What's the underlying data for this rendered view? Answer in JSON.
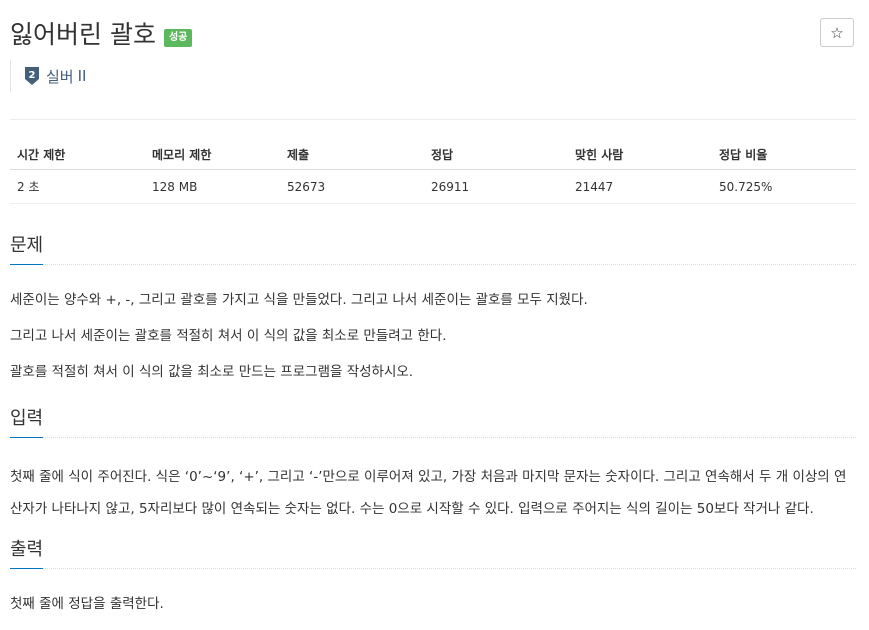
{
  "problem": {
    "title": "잃어버린 괄호",
    "result_badge": "성공",
    "favorite_icon": "☆",
    "tier": {
      "icon": "silver-tier-2-icon",
      "icon_number": "2",
      "name": "실버",
      "level": "II",
      "color": "#435f7a"
    }
  },
  "info_table": {
    "headers": [
      "시간 제한",
      "메모리 제한",
      "제출",
      "정답",
      "맞힌 사람",
      "정답 비율"
    ],
    "values": [
      "2 초",
      "128 MB",
      "52673",
      "26911",
      "21447",
      "50.725%"
    ]
  },
  "sections": {
    "description": {
      "title": "문제",
      "paragraphs": [
        "세준이는 양수와 +, -, 그리고 괄호를 가지고 식을 만들었다. 그리고 나서 세준이는 괄호를 모두 지웠다.",
        "그리고 나서 세준이는 괄호를 적절히 쳐서 이 식의 값을 최소로 만들려고 한다.",
        "괄호를 적절히 쳐서 이 식의 값을 최소로 만드는 프로그램을 작성하시오."
      ]
    },
    "input": {
      "title": "입력",
      "paragraphs": [
        "첫째 줄에 식이 주어진다. 식은 ‘0’~‘9’, ‘+’, 그리고 ‘-’만으로 이루어져 있고, 가장 처음과 마지막 문자는 숫자이다. 그리고 연속해서 두 개 이상의 연산자가 나타나지 않고, 5자리보다 많이 연속되는 숫자는 없다. 수는 0으로 시작할 수 있다. 입력으로 주어지는 식의 길이는 50보다 작거나 같다."
      ]
    },
    "output": {
      "title": "출력",
      "paragraphs": [
        "첫째 줄에 정답을 출력한다."
      ]
    }
  },
  "colors": {
    "success_badge": "#5cb85c",
    "section_underline": "#0076c0",
    "tier_silver": "#435f7a"
  }
}
